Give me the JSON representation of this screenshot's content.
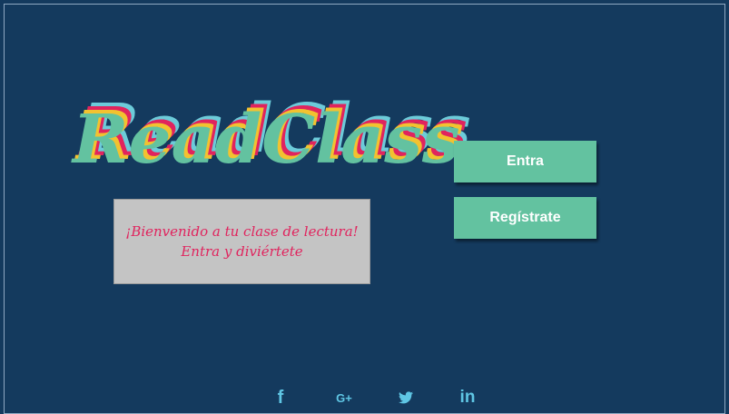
{
  "logo": {
    "text": "ReadClass",
    "colors": [
      "#6ccbd9",
      "#f2c230",
      "#e0245e",
      "#63c2a0"
    ]
  },
  "welcome": {
    "line1": "¡Bienvenido a tu clase de lectura!",
    "line2": "Entra y diviértete"
  },
  "buttons": {
    "entra": "Entra",
    "registrate": "Regístrate"
  },
  "social": {
    "facebook": "f",
    "google_plus": "G+",
    "twitter": "twitter-icon",
    "linkedin": "in"
  },
  "colors": {
    "background": "#143a5e",
    "button": "#63c2a0",
    "accent_pink": "#e0245e",
    "social": "#5fc6e4"
  }
}
